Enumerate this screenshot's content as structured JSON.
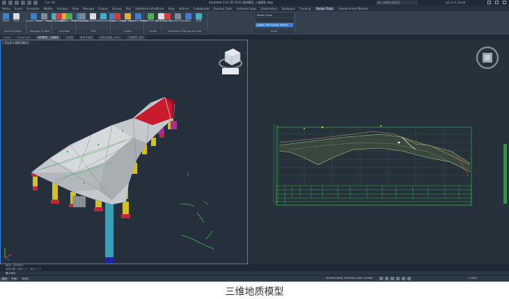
{
  "titlebar": {
    "file_tab": "Civil 3D",
    "title": "Autodesk Civil 3D 2022   地质模型_三维模型.dwg",
    "search_placeholder": "键入关键字或短语",
    "user": "gd_civil_fenpb"
  },
  "menubar": {
    "tabs": [
      "Home",
      "Insert",
      "Annotate",
      "Modify",
      "Analyze",
      "View",
      "Manage",
      "Output",
      "Survey",
      "Rail",
      "Autodesk InfraWorks",
      "Help",
      "Add-ins",
      "Collaborate",
      "Express Tools",
      "Featured Apps",
      "Geolocation",
      "Toolspace",
      "Tracking",
      "Raster Tools",
      "Geotechnical Module"
    ],
    "active": "Raster Tools"
  },
  "ribbon": {
    "panels": [
      {
        "title": "Insert & Write",
        "buttons": [
          "Insert",
          "Save"
        ]
      },
      {
        "title": "Manage & View",
        "buttons": [
          "Image Frame",
          "Insert Image",
          "Image Transp",
          "Cut"
        ]
      },
      {
        "title": "Correlate",
        "buttons": [
          "Correlate",
          "Rubber Sheet",
          "Match Quality"
        ]
      },
      {
        "title": "Edit",
        "buttons": [
          "Touchup",
          "Despeckle",
          "Remove",
          "Crop"
        ]
      },
      {
        "title": "Create",
        "buttons": [
          "Primitive Image",
          "Create Region",
          "Enhanced Region"
        ]
      },
      {
        "title": "Create",
        "buttons": [
          "Create REM Hatch",
          "Vectorize"
        ]
      },
      {
        "title": "Vectorize & Recognize Text",
        "buttons": [
          "Polyline",
          "Polyline Follow",
          "Text",
          "OCR"
        ]
      },
      {
        "title": "Snap",
        "buttons": [
          "Raster Snap",
          "Snap Settings"
        ]
      }
    ],
    "raster_snap": {
      "row1": "Raster Snap",
      "row2": "",
      "row3": "Lower Left Corner Select"
    }
  },
  "doctabs": [
    "Start",
    "Drawing1*",
    "地质模型_三维模型",
    "剖面图",
    "基础平面图",
    "地质剖面图_ABCD",
    "三维模型_管线"
  ],
  "doctab_active_index": 2,
  "viewports": {
    "left_label": "[-][自定义视图][概念]",
    "right_label": ""
  },
  "command": {
    "line1": "命令: _VPORTS",
    "line2": "选择对象: 找到 1 个，总计 1 个",
    "prompt": "键入命令"
  },
  "status": {
    "layouts": [
      "模型",
      "布局1",
      "布局2"
    ],
    "coords": "395958.3048, 3019482.0525, 0.0000",
    "mode": "模型",
    "scale": "1:1000"
  },
  "caption": "三维地质模型",
  "colors": {
    "background": "#2a3440",
    "viewport_border": "#3f86d8",
    "ribbon": "#34404e",
    "terrain": "#c8ccd0",
    "pier_yellow": "#d4c020",
    "pier_red": "#c02838",
    "pile_cyan": "#3aa0b8",
    "section_green": "#35c04a"
  }
}
